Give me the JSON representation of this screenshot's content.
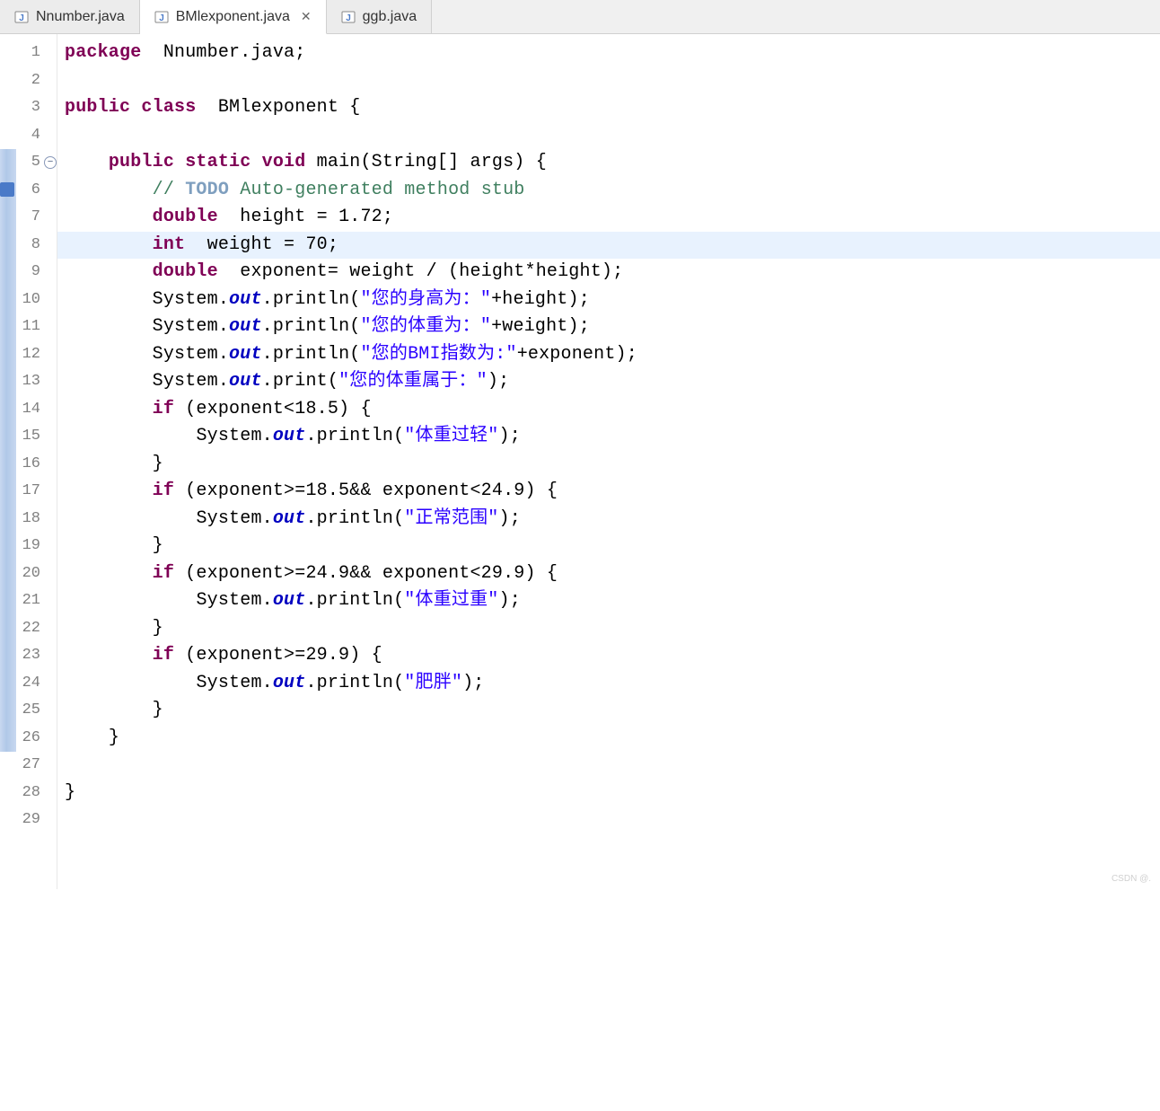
{
  "tabs": [
    {
      "label": "Nnumber.java",
      "active": false,
      "closeable": false
    },
    {
      "label": "BMlexponent.java",
      "active": true,
      "closeable": true
    },
    {
      "label": "ggb.java",
      "active": false,
      "closeable": false
    }
  ],
  "lineCount": 29,
  "highlightedLine": 8,
  "foldLine": 5,
  "quickfixLine": 6,
  "markerBar": {
    "startLine": 5,
    "endLine": 26
  },
  "code": {
    "l1": {
      "kw1": "package",
      "t1": " Nnumber.java;"
    },
    "l2": "",
    "l3": {
      "kw1": "public",
      "kw2": "class",
      "t1": " BMlexponent {"
    },
    "l4": "",
    "l5": {
      "pad": "    ",
      "kw1": "public",
      "kw2": "static",
      "kw3": "void",
      "t1": " main(String[] args) {"
    },
    "l6": {
      "pad": "        ",
      "c1": "// ",
      "td": "TODO",
      "c2": " Auto-generated method stub"
    },
    "l7": {
      "pad": "        ",
      "kw1": "double",
      "t1": " height = 1.72;"
    },
    "l8": {
      "pad": "        ",
      "kw1": "int",
      "t1": " weight = 70;"
    },
    "l9": {
      "pad": "        ",
      "kw1": "double",
      "t1": " exponent= weight / (height*height);"
    },
    "l10": {
      "pad": "        ",
      "t1": "System.",
      "fd": "out",
      "t2": ".println(",
      "s": "\"您的身高为：\"",
      "t3": "+height);"
    },
    "l11": {
      "pad": "        ",
      "t1": "System.",
      "fd": "out",
      "t2": ".println(",
      "s": "\"您的体重为：\"",
      "t3": "+weight);"
    },
    "l12": {
      "pad": "        ",
      "t1": "System.",
      "fd": "out",
      "t2": ".println(",
      "s": "\"您的BMI指数为:\"",
      "t3": "+exponent);"
    },
    "l13": {
      "pad": "        ",
      "t1": "System.",
      "fd": "out",
      "t2": ".print(",
      "s": "\"您的体重属于：\"",
      "t3": ");"
    },
    "l14": {
      "pad": "        ",
      "kw1": "if",
      "t1": "(exponent<18.5) {"
    },
    "l15": {
      "pad": "            ",
      "t1": "System.",
      "fd": "out",
      "t2": ".println(",
      "s": "\"体重过轻\"",
      "t3": ");"
    },
    "l16": {
      "pad": "        ",
      "t1": "}"
    },
    "l17": {
      "pad": "        ",
      "kw1": "if",
      "t1": "(exponent>=18.5&& exponent<24.9) {"
    },
    "l18": {
      "pad": "            ",
      "t1": "System.",
      "fd": "out",
      "t2": ".println(",
      "s": "\"正常范围\"",
      "t3": ");"
    },
    "l19": {
      "pad": "        ",
      "t1": "}"
    },
    "l20": {
      "pad": "        ",
      "kw1": "if",
      "t1": "(exponent>=24.9&& exponent<29.9) {"
    },
    "l21": {
      "pad": "            ",
      "t1": "System.",
      "fd": "out",
      "t2": ".println(",
      "s": "\"体重过重\"",
      "t3": ");"
    },
    "l22": {
      "pad": "        ",
      "t1": "}"
    },
    "l23": {
      "pad": "        ",
      "kw1": "if",
      "t1": "(exponent>=29.9) {"
    },
    "l24": {
      "pad": "            ",
      "t1": "System.",
      "fd": "out",
      "t2": ".println(",
      "s": "\"肥胖\"",
      "t3": ");"
    },
    "l25": {
      "pad": "        ",
      "t1": "}"
    },
    "l26": {
      "pad": "    ",
      "t1": "}"
    },
    "l27": "",
    "l28": {
      "t1": "}"
    },
    "l29": ""
  },
  "watermark": "CSDN @."
}
